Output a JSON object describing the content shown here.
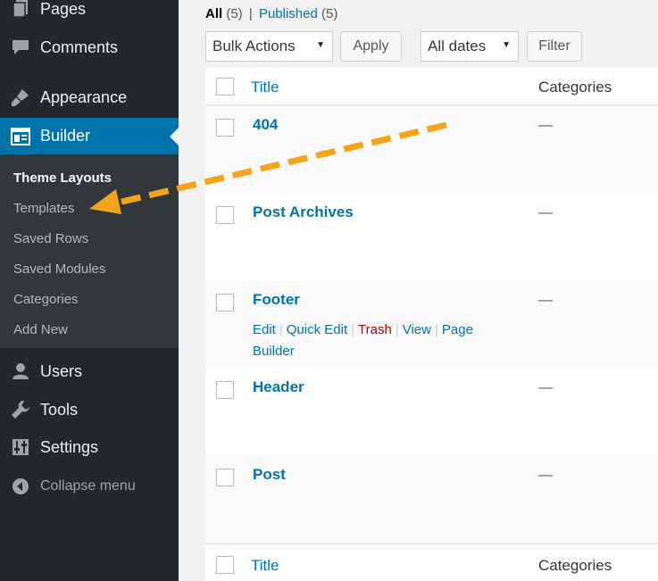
{
  "sidebar": {
    "menu": [
      {
        "label": "Pages",
        "icon": "pages-icon"
      },
      {
        "label": "Comments",
        "icon": "comments-icon"
      },
      {
        "label": "Appearance",
        "icon": "appearance-brush-icon"
      },
      {
        "label": "Builder",
        "icon": "builder-layout-icon"
      }
    ],
    "submenu": [
      "Theme Layouts",
      "Templates",
      "Saved Rows",
      "Saved Modules",
      "Categories",
      "Add New"
    ],
    "menu_bottom": [
      {
        "label": "Users",
        "icon": "users-icon"
      },
      {
        "label": "Tools",
        "icon": "tools-wrench-icon"
      },
      {
        "label": "Settings",
        "icon": "settings-sliders-icon"
      }
    ],
    "collapse_label": "Collapse menu"
  },
  "filters": {
    "all_label": "All",
    "all_count": "(5)",
    "separator": "|",
    "published_label": "Published",
    "published_count": "(5)"
  },
  "controls": {
    "bulk_actions": "Bulk Actions",
    "apply": "Apply",
    "dates": "All dates",
    "filter": "Filter"
  },
  "table": {
    "col_title": "Title",
    "col_categories": "Categories",
    "rows": [
      {
        "title": "404",
        "category": "—"
      },
      {
        "title": "Post Archives",
        "category": "—"
      },
      {
        "title": "Footer",
        "category": "—"
      },
      {
        "title": "Header",
        "category": "—"
      },
      {
        "title": "Post",
        "category": "—"
      }
    ],
    "row_actions": {
      "edit": "Edit",
      "quick_edit": "Quick Edit",
      "trash": "Trash",
      "view": "View",
      "page_builder": "Page Builder",
      "sep": "|"
    }
  },
  "colors": {
    "sidebar_bg": "#23282d",
    "submenu_bg": "#32373c",
    "active_bg": "#0073aa",
    "link": "#0073aa",
    "trash": "#aa0000",
    "arrow": "#f2a51a"
  }
}
